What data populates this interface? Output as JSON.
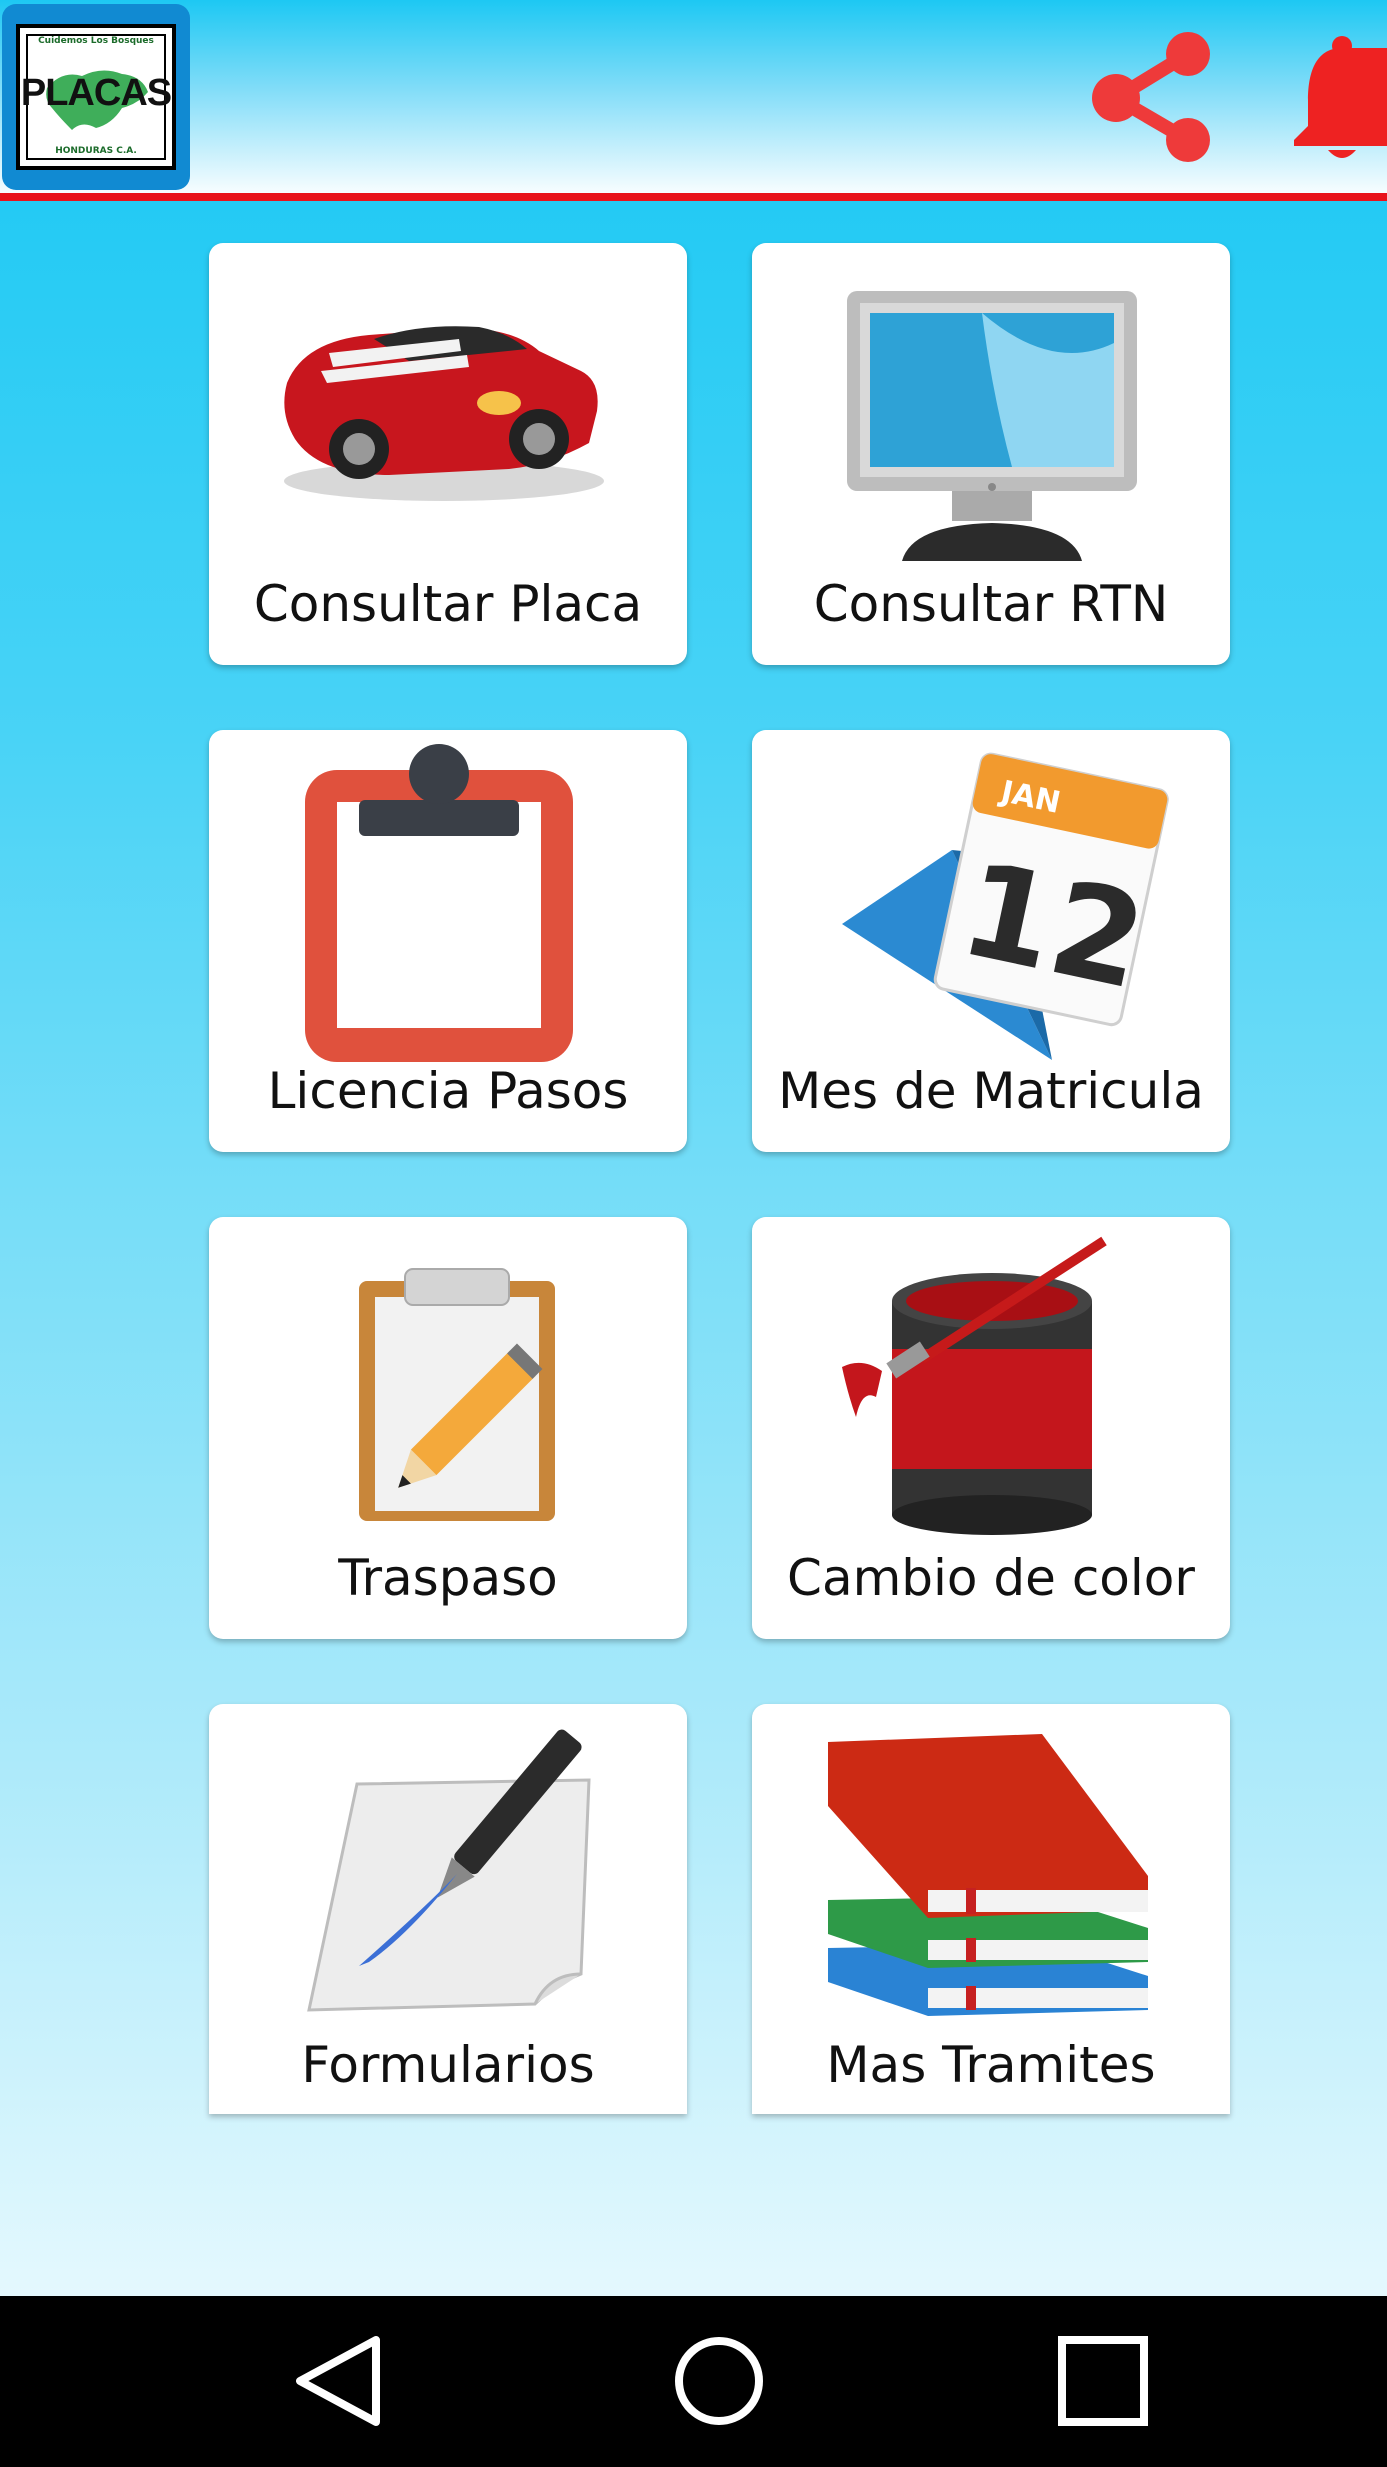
{
  "header": {
    "logo": {
      "text": "PLACAS",
      "top_text": "Cuidemos Los Bosques",
      "bottom_text": "HONDURAS C.A."
    },
    "actions": [
      {
        "icon": "share-icon"
      },
      {
        "icon": "bell-icon"
      }
    ],
    "accent_line_color": "#e8121b"
  },
  "menu": {
    "items": [
      {
        "label": "Consultar Placa",
        "icon": "car-icon"
      },
      {
        "label": "Consultar RTN",
        "icon": "monitor-icon"
      },
      {
        "label": "Licencia Pasos",
        "icon": "clipboard-icon"
      },
      {
        "label": "Mes de Matricula",
        "icon": "calendar-icon",
        "calendar_month": "JAN",
        "calendar_day": "12"
      },
      {
        "label": "Traspaso",
        "icon": "clipboard-pencil-icon"
      },
      {
        "label": "Cambio de color",
        "icon": "paint-can-icon"
      },
      {
        "label": "Formularios",
        "icon": "pen-paper-icon"
      },
      {
        "label": "Mas Tramites",
        "icon": "books-icon"
      }
    ]
  },
  "navbar": {
    "buttons": [
      {
        "icon": "back-icon"
      },
      {
        "icon": "home-icon"
      },
      {
        "icon": "recents-icon"
      }
    ]
  }
}
